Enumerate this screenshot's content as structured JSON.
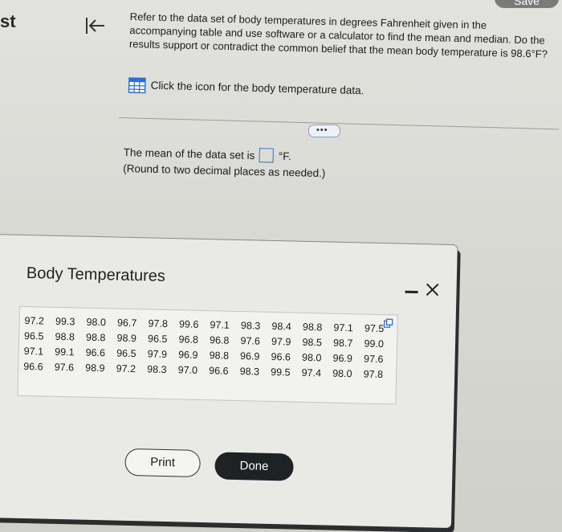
{
  "sidebar": {
    "fragment": "st"
  },
  "header": {
    "save_label": "Save"
  },
  "question": {
    "text": "Refer to the data set of body temperatures in degrees Fahrenheit given in the accompanying table and use software or a calculator to find the mean and median. Do the results support or contradict the common belief that the mean body temperature is 98.6°F?",
    "data_link_label": "Click the icon for the body temperature data.",
    "expand_label": "•••"
  },
  "answer": {
    "prefix": "The mean of the data set is",
    "suffix": "°F.",
    "note": "(Round to two decimal places as needed.)"
  },
  "dialog": {
    "title": "Body Temperatures",
    "rows": [
      [
        "97.2",
        "99.3",
        "98.0",
        "96.7",
        "97.8",
        "99.6",
        "97.1",
        "98.3",
        "98.4",
        "98.8",
        "97.1",
        "97.5"
      ],
      [
        "96.5",
        "98.8",
        "98.8",
        "98.9",
        "96.5",
        "96.8",
        "96.8",
        "97.6",
        "97.9",
        "98.5",
        "98.7",
        "99.0"
      ],
      [
        "97.1",
        "99.1",
        "96.6",
        "96.5",
        "97.9",
        "96.9",
        "98.8",
        "96.9",
        "96.6",
        "98.0",
        "96.9",
        "97.6"
      ],
      [
        "96.6",
        "97.6",
        "98.9",
        "97.2",
        "98.3",
        "97.0",
        "96.6",
        "98.3",
        "99.5",
        "97.4",
        "98.0",
        "97.8"
      ]
    ],
    "print_label": "Print",
    "done_label": "Done"
  },
  "colors": {
    "answer_box_border": "#3a6fc2",
    "done_button_bg": "#1f2224",
    "table_icon": "#2d6fd6"
  }
}
